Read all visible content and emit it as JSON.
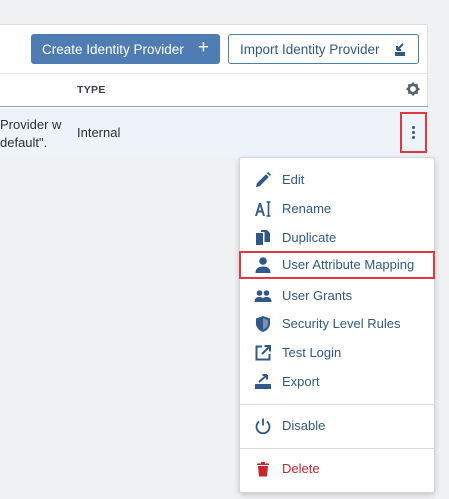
{
  "toolbar": {
    "create_label": "Create Identity Provider",
    "create_icon": "plus-icon",
    "import_label": "Import Identity Provider",
    "import_icon": "import-icon"
  },
  "table": {
    "columns": [
      "TYPE"
    ],
    "settings_icon": "gear-icon",
    "rows": [
      {
        "description_line1": "Provider w",
        "description_line2": "default\".",
        "type": "Internal",
        "actions_icon": "kebab-menu-icon"
      }
    ]
  },
  "menu": {
    "items": [
      {
        "label": "Edit",
        "icon": "pencil-icon"
      },
      {
        "label": "Rename",
        "icon": "rename-icon"
      },
      {
        "label": "Duplicate",
        "icon": "duplicate-icon"
      },
      {
        "label": "User Attribute Mapping",
        "icon": "user-icon",
        "highlighted": true
      },
      {
        "label": "User Grants",
        "icon": "users-icon"
      },
      {
        "label": "Security Level Rules",
        "icon": "shield-icon"
      },
      {
        "label": "Test Login",
        "icon": "external-link-icon"
      },
      {
        "label": "Export",
        "icon": "export-icon"
      },
      {
        "label": "Disable",
        "icon": "power-icon"
      },
      {
        "label": "Delete",
        "icon": "trash-icon",
        "danger": true
      }
    ]
  },
  "colors": {
    "primary": "#4f7cb3",
    "link": "#30588a",
    "highlight_border": "#e0393e",
    "danger": "#c8252c",
    "row_selected": "#eef3fa"
  }
}
